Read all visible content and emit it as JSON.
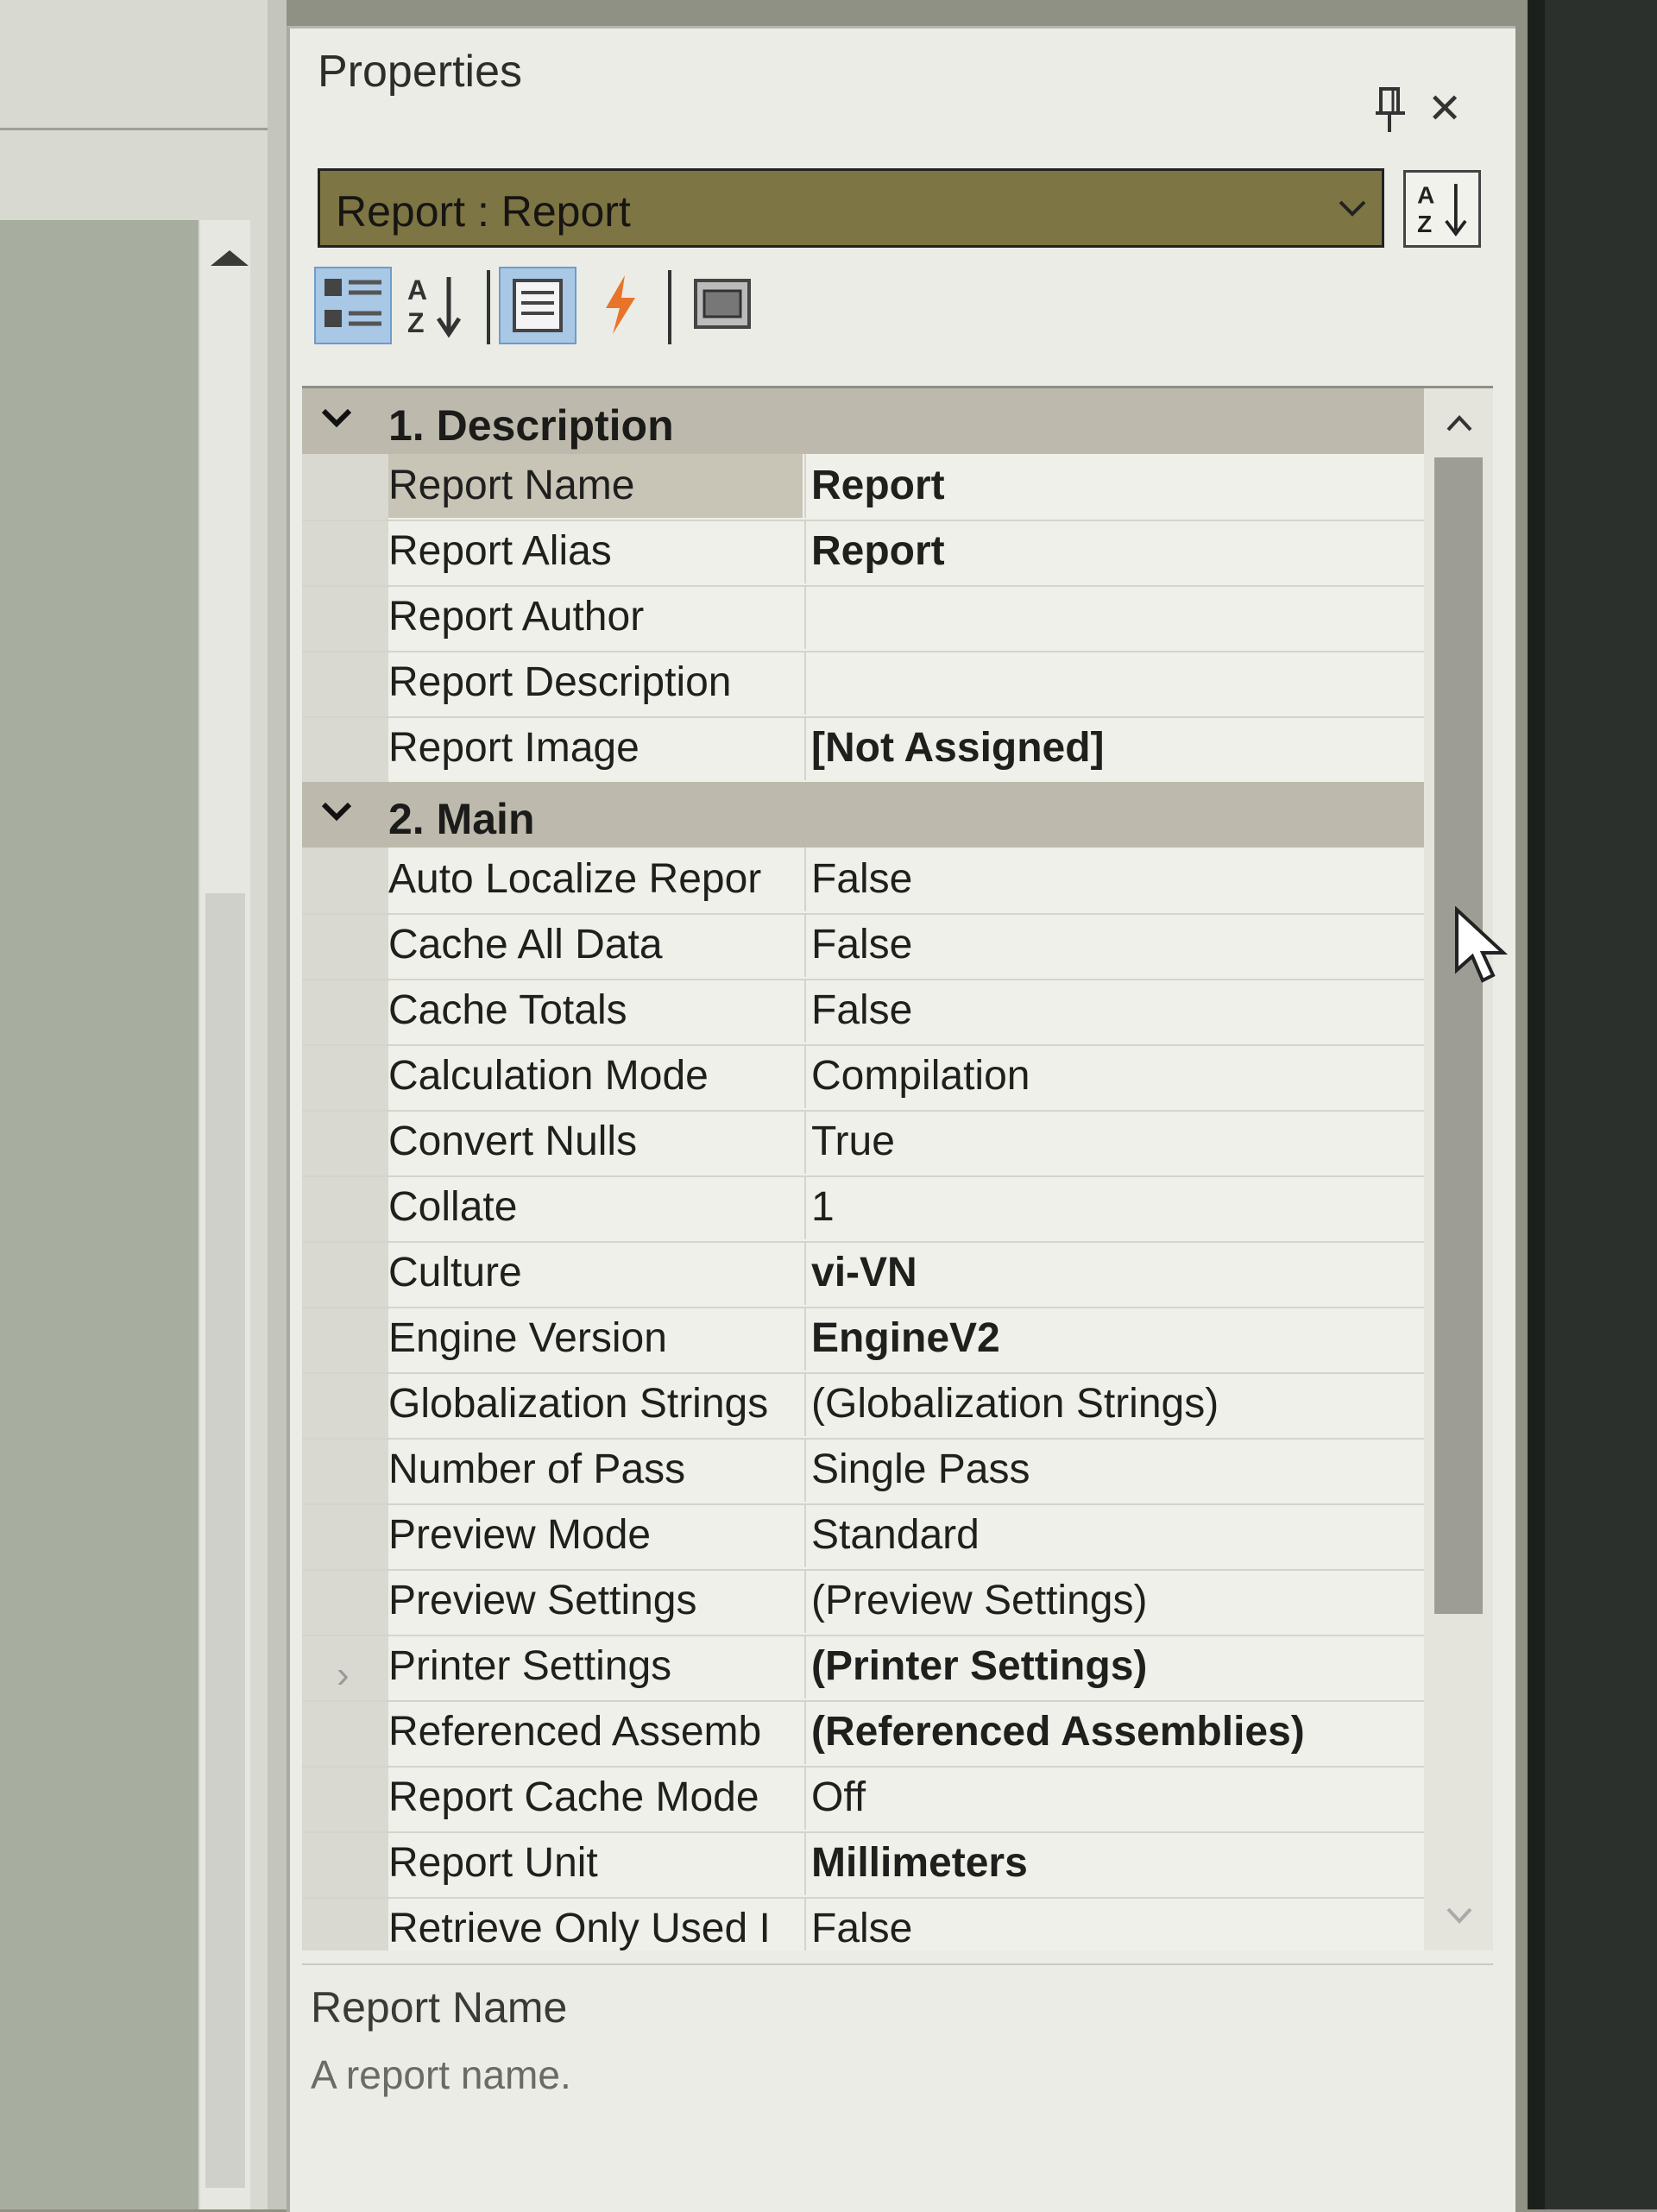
{
  "panel": {
    "title": "Properties",
    "object_selector": "Report : Report",
    "icons": {
      "pin": "pin-icon",
      "close": "close-icon",
      "sort": "sort-az-icon",
      "categorized": "categorized-view-icon",
      "alphabetical": "sort-alphabetical-icon",
      "properties": "properties-tab-icon",
      "events": "events-lightning-icon",
      "property_pages": "property-pages-icon"
    }
  },
  "grid": {
    "categories": [
      {
        "label": "1. Description",
        "properties": [
          {
            "name": "Report Name",
            "value": "Report",
            "bold": true,
            "selected": true
          },
          {
            "name": "Report Alias",
            "value": "Report",
            "bold": true
          },
          {
            "name": "Report Author",
            "value": ""
          },
          {
            "name": "Report Description",
            "value": ""
          },
          {
            "name": "Report Image",
            "value": "[Not Assigned]",
            "bold": true
          }
        ]
      },
      {
        "label": "2. Main",
        "properties": [
          {
            "name": "Auto Localize Repor",
            "value": "False"
          },
          {
            "name": "Cache All Data",
            "value": "False"
          },
          {
            "name": "Cache Totals",
            "value": "False"
          },
          {
            "name": "Calculation Mode",
            "value": "Compilation"
          },
          {
            "name": "Convert Nulls",
            "value": "True"
          },
          {
            "name": "Collate",
            "value": "1"
          },
          {
            "name": "Culture",
            "value": "vi-VN",
            "bold": true
          },
          {
            "name": "Engine Version",
            "value": "EngineV2",
            "bold": true
          },
          {
            "name": "Globalization Strings",
            "value": "(Globalization Strings)"
          },
          {
            "name": "Number of Pass",
            "value": "Single Pass"
          },
          {
            "name": "Preview Mode",
            "value": "Standard"
          },
          {
            "name": "Preview Settings",
            "value": "(Preview Settings)"
          },
          {
            "name": "Printer Settings",
            "value": "(Printer Settings)",
            "bold": true,
            "expandable": true
          },
          {
            "name": "Referenced Assemb",
            "value": "(Referenced Assemblies)",
            "bold": true
          },
          {
            "name": "Report Cache Mode",
            "value": "Off"
          },
          {
            "name": "Report Unit",
            "value": "Millimeters",
            "bold": true
          },
          {
            "name": "Retrieve Only Used I",
            "value": "False"
          }
        ]
      }
    ]
  },
  "description": {
    "title": "Report Name",
    "text": "A report name."
  },
  "colors": {
    "selector_bg": "#7e7544",
    "category_bg": "#bdb9ac",
    "active_tool": "#a8c8e6",
    "events_icon": "#e8742a"
  }
}
